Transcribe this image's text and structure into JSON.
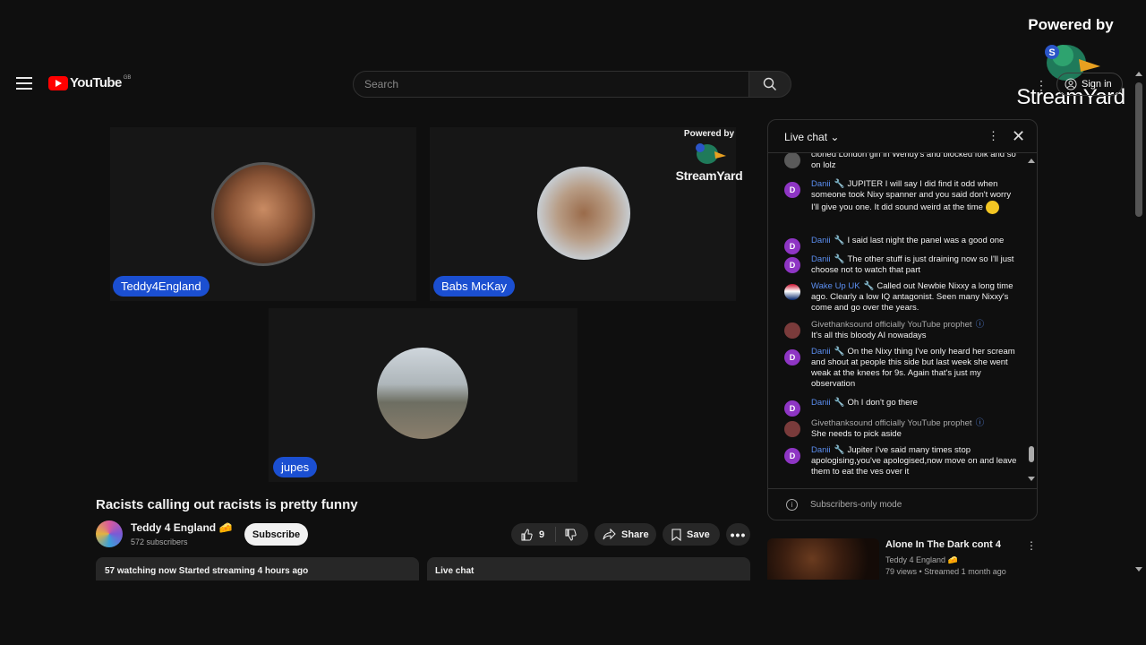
{
  "header": {
    "logo_text": "YouTube",
    "country_code": "GB",
    "search_placeholder": "Search",
    "sign_in_label": "Sign in"
  },
  "overlay_badge": {
    "powered_by": "Powered by",
    "brand": "StreamYard"
  },
  "video": {
    "badge_powered_by": "Powered by",
    "badge_brand": "StreamYard",
    "participants": [
      {
        "name": "Teddy4England"
      },
      {
        "name": "Babs McKay"
      },
      {
        "name": "jupes"
      }
    ],
    "title": "Racists calling out racists is pretty funny"
  },
  "channel": {
    "name": "Teddy 4 England 🧀",
    "subscribers": "572 subscribers",
    "subscribe_label": "Subscribe"
  },
  "actions": {
    "like_count": "9",
    "share_label": "Share",
    "save_label": "Save",
    "more_label": "•••"
  },
  "description_bar": "57 watching now  Started streaming 4 hours ago",
  "chat_bar_label": "Live chat",
  "live_chat": {
    "header": "Live chat",
    "footer": "Subscribers-only mode",
    "messages": [
      {
        "author": "",
        "text": "cloned London girl in Wendy's and blocked folk and so on lolz"
      },
      {
        "author": "Danii",
        "text": "JUPITER I will say I did find it odd when someone took Nixy spanner and you said don't worry I'll give you one. It did sound weird at the time"
      },
      {
        "author": "Danii",
        "text": "I said last night the panel was a good one"
      },
      {
        "author": "Danii",
        "text": "The other stuff is just draining now so I'll just choose not to watch that part"
      },
      {
        "author": "Wake Up UK",
        "text": "Called out Newbie Nixxy a long time ago. Clearly a low IQ antagonist. Seen many Nixxy's come and go over the years."
      },
      {
        "author": "Givethanksound officially YouTube prophet",
        "text": "It's all this bloody AI nowadays"
      },
      {
        "author": "Danii",
        "text": "On the Nixy thing I've only heard her scream and shout at people this side but last week she went weak at the knees for 9s. Again that's just my observation"
      },
      {
        "author": "Danii",
        "text": "Oh I don't go there"
      },
      {
        "author": "Givethanksound officially YouTube prophet",
        "text": "She needs to pick aside"
      },
      {
        "author": "Danii",
        "text": "Jupiter I've said many times stop apologising,you've apologised,now move on and leave them to eat the  ves over it"
      }
    ]
  },
  "recommended": {
    "title": "Alone In The Dark cont 4",
    "channel": "Teddy 4 England 🧀",
    "meta": "79 views  • Streamed 1 month ago"
  },
  "colors": {
    "background": "#0f0f0f",
    "name_tag": "#1b4fd1",
    "chat_author": "#5b8ef0",
    "youtube_red": "#ff0000"
  }
}
